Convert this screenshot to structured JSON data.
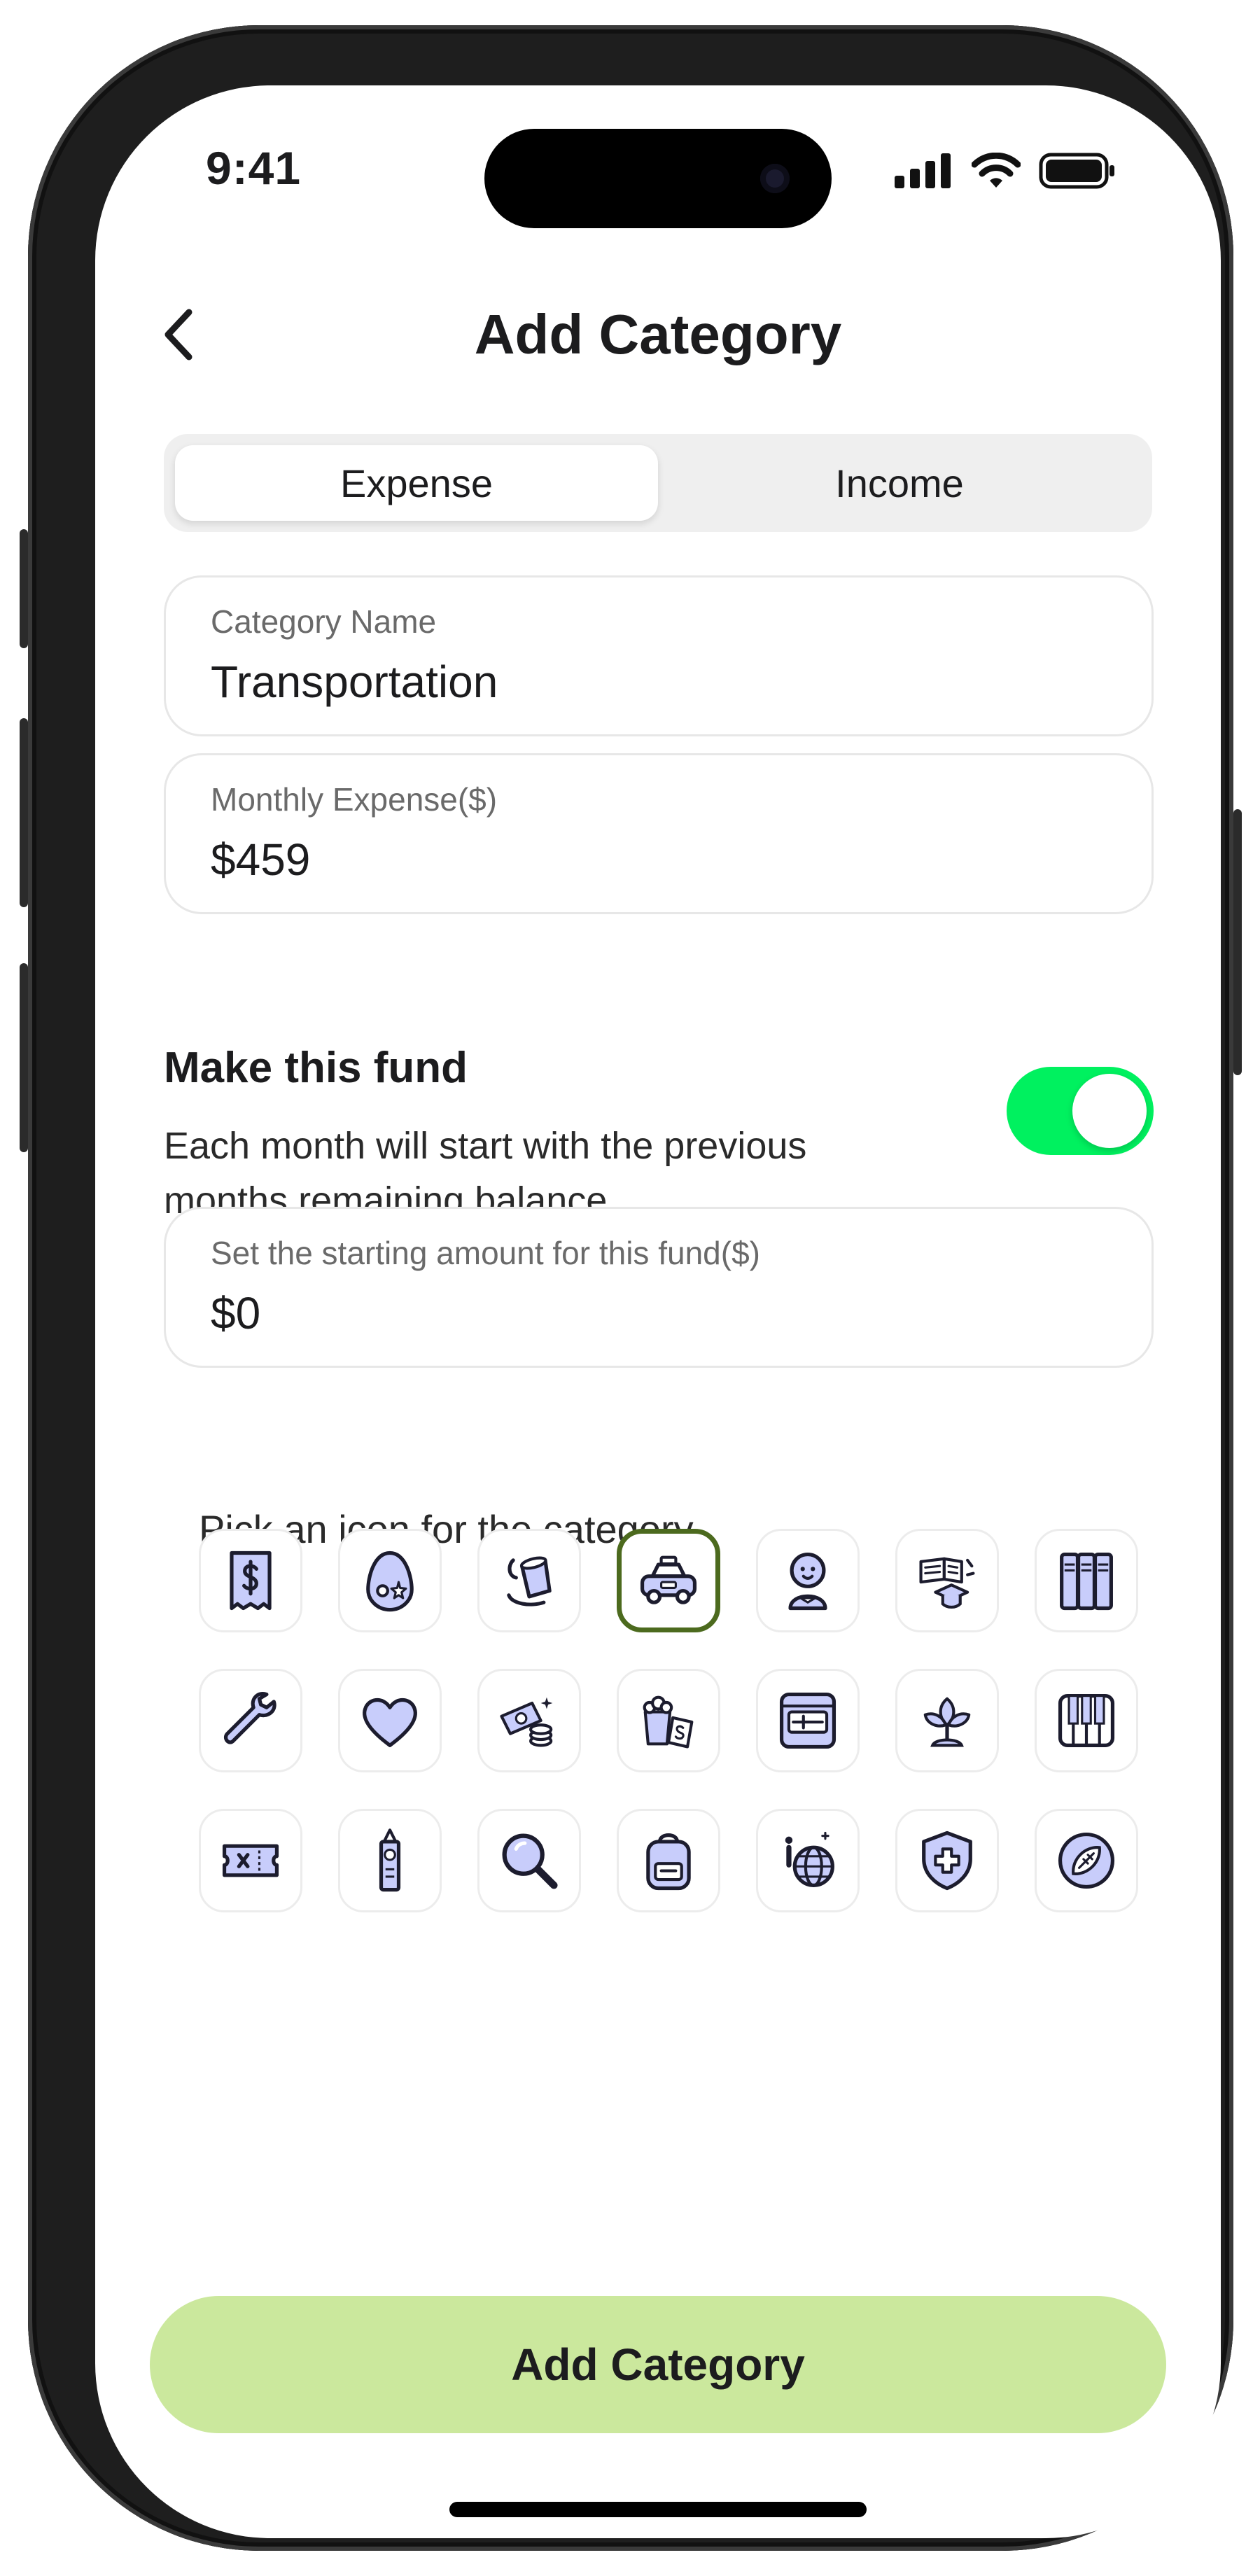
{
  "status_bar": {
    "time": "9:41"
  },
  "header": {
    "title": "Add Category"
  },
  "segmented": {
    "expense_label": "Expense",
    "income_label": "Income",
    "selected": "Expense"
  },
  "fields": {
    "category_name": {
      "label": "Category Name",
      "value": "Transportation"
    },
    "monthly_expense": {
      "label": "Monthly Expense($)",
      "value": "$459"
    },
    "starting_amount": {
      "label": "Set the starting amount for this fund($)",
      "value": "$0"
    }
  },
  "fund": {
    "title": "Make this fund",
    "description": "Each month will start with the previous months remaining balance",
    "enabled": true
  },
  "icon_picker": {
    "label": "Pick an icon for the category",
    "icons": [
      "receipt-icon",
      "egg-icon",
      "cup-icon",
      "taxi-icon",
      "baby-icon",
      "education-icon",
      "binders-icon",
      "wrench-icon",
      "heart-icon",
      "cash-coins-icon",
      "popcorn-ticket-icon",
      "cash-register-icon",
      "plant-icon",
      "piano-icon",
      "ticket-icon",
      "tower-icon",
      "magnifier-icon",
      "backpack-icon",
      "globe-info-icon",
      "medical-shield-icon",
      "football-icon"
    ],
    "selected_index": 3
  },
  "cta": {
    "label": "Add Category"
  },
  "colors": {
    "accent_green": "#00f15f",
    "cta_green": "#cbe89d",
    "icon_fill": "#c8cdfb",
    "selected_border": "#4c6a1e"
  }
}
